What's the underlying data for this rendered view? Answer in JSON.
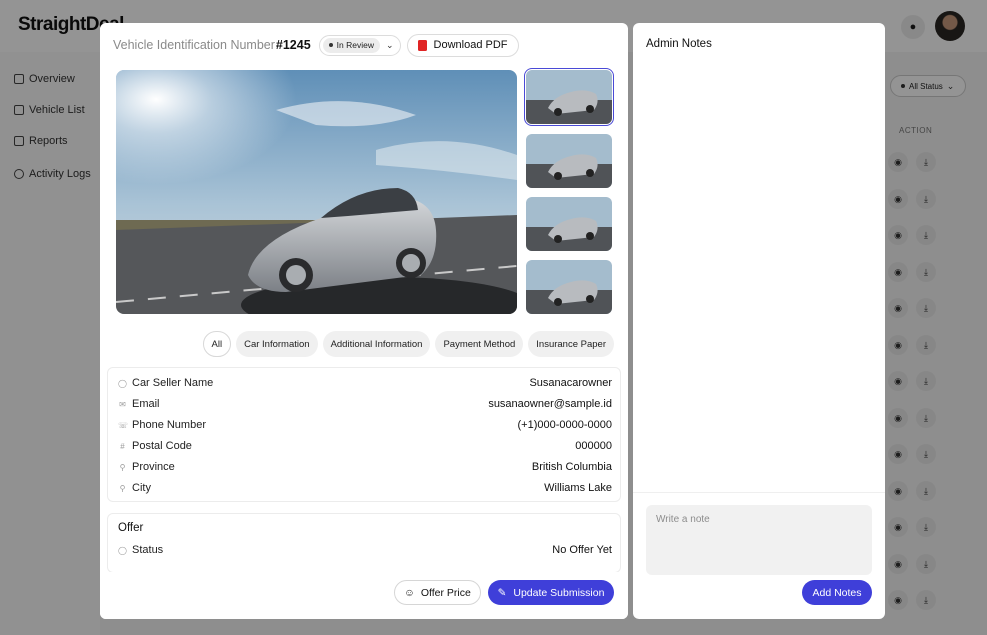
{
  "background": {
    "logo": "StraightDeal",
    "nav": [
      {
        "label": "Overview",
        "icon": "grid-icon"
      },
      {
        "label": "Vehicle List",
        "icon": "car-icon"
      },
      {
        "label": "Reports",
        "icon": "monitor-icon"
      },
      {
        "label": "Activity Logs",
        "icon": "history-icon"
      }
    ],
    "filter_label": "All Status",
    "action_header": "ACTION"
  },
  "header": {
    "vin_label": "Vehicle Identification Number",
    "vin_number": "#1245",
    "status": "In Review",
    "download_label": "Download PDF"
  },
  "tabs": [
    "All",
    "Car Information",
    "Additional Information",
    "Payment Method",
    "Insurance Paper"
  ],
  "info": [
    {
      "label": "Car Seller Name",
      "value": "Susanacarowner",
      "icon": "user-icon"
    },
    {
      "label": "Email",
      "value": "susanaowner@sample.id",
      "icon": "mail-icon"
    },
    {
      "label": "Phone Number",
      "value": "(+1)000-0000-0000",
      "icon": "phone-icon"
    },
    {
      "label": "Postal Code",
      "value": "000000",
      "icon": "hash-icon"
    },
    {
      "label": "Province",
      "value": "British Columbia",
      "icon": "pin-icon"
    },
    {
      "label": "City",
      "value": "Williams Lake",
      "icon": "pin-icon"
    }
  ],
  "offer": {
    "title": "Offer",
    "status_label": "Status",
    "status_value": "No Offer Yet"
  },
  "footer": {
    "offer_price_label": "Offer Price",
    "update_label": "Update Submission"
  },
  "notes": {
    "title": "Admin Notes",
    "placeholder": "Write a note",
    "add_label": "Add Notes"
  },
  "colors": {
    "accent": "#3f3fd9",
    "pdf": "#e02424"
  }
}
